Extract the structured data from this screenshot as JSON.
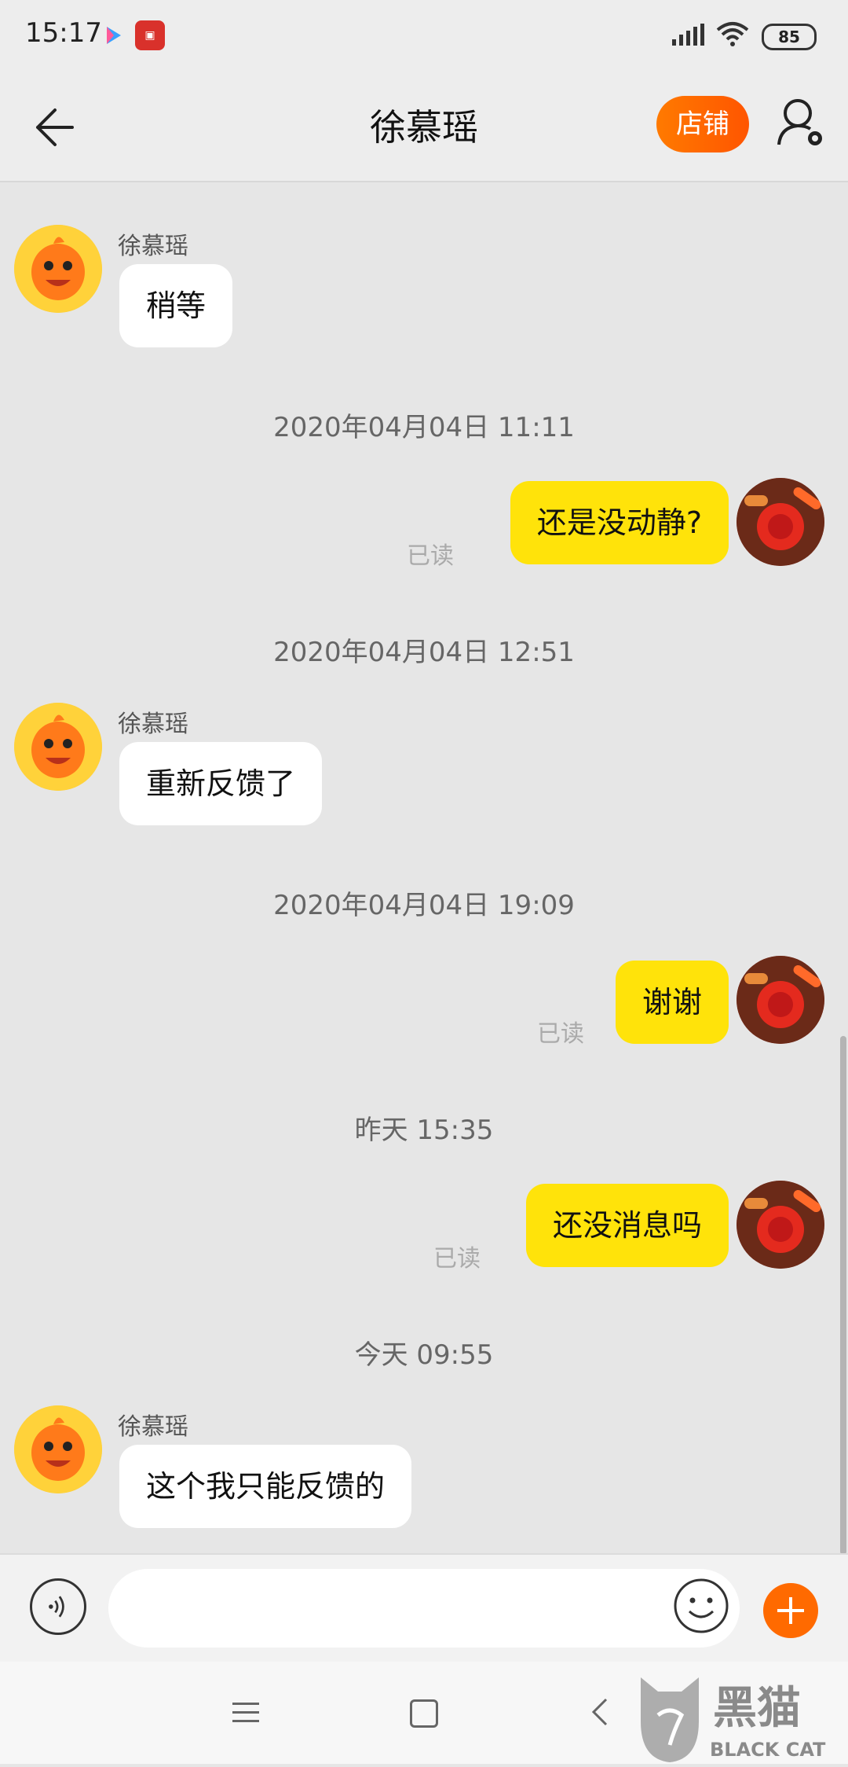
{
  "status_bar": {
    "time": "15:17",
    "battery": "85"
  },
  "header": {
    "title": "徐慕瑶",
    "shop_label": "店铺"
  },
  "messages": [
    {
      "side": "left",
      "sender": "徐慕瑶",
      "text": "稍等"
    },
    {
      "timestamp": "2020年04月04日 11:11"
    },
    {
      "side": "right",
      "text": "还是没动静?",
      "read": "已读"
    },
    {
      "timestamp": "2020年04月04日 12:51"
    },
    {
      "side": "left",
      "sender": "徐慕瑶",
      "text": "重新反馈了"
    },
    {
      "timestamp": "2020年04月04日 19:09"
    },
    {
      "side": "right",
      "text": "谢谢",
      "read": "已读"
    },
    {
      "timestamp": "昨天 15:35"
    },
    {
      "side": "right",
      "text": "还没消息吗",
      "read": "已读"
    },
    {
      "timestamp": "今天 09:55"
    },
    {
      "side": "left",
      "sender": "徐慕瑶",
      "text": "这个我只能反馈的"
    }
  ],
  "input": {
    "placeholder": ""
  },
  "watermark": {
    "brand_cn": "黑猫",
    "brand_en": "BLACK CAT"
  },
  "colors": {
    "accent": "#ff6a00",
    "my_bubble": "#ffe30a",
    "their_bubble": "#ffffff",
    "background": "#e6e6e6"
  }
}
